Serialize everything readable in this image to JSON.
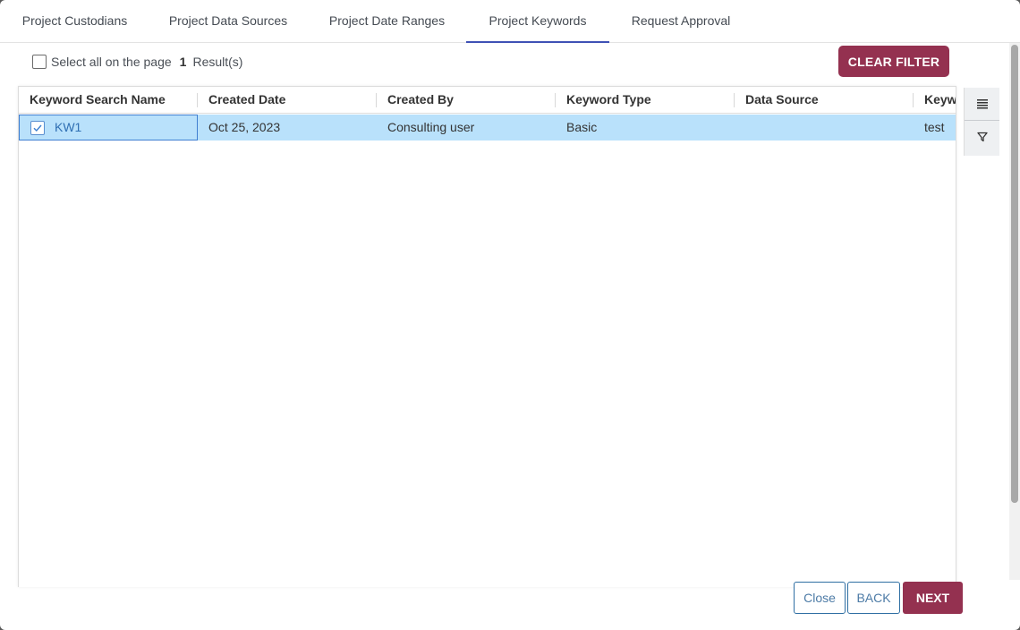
{
  "tabs": [
    {
      "label": "Project Custodians"
    },
    {
      "label": "Project Data Sources"
    },
    {
      "label": "Project Date Ranges"
    },
    {
      "label": "Project Keywords",
      "active": true
    },
    {
      "label": "Request Approval"
    }
  ],
  "toolbar": {
    "select_all_label": "Select all on the page",
    "result_count": "1",
    "results_label": "Result(s)",
    "clear_filter_label": "CLEAR FILTER"
  },
  "grid": {
    "columns": [
      "Keyword Search Name",
      "Created Date",
      "Created By",
      "Keyword Type",
      "Data Source",
      "Keyw"
    ],
    "rows": [
      {
        "selected": true,
        "keyword_search_name": "KW1",
        "created_date": "Oct 25, 2023",
        "created_by": "Consulting user",
        "keyword_type": "Basic",
        "data_source": "",
        "keywords": "test"
      }
    ]
  },
  "side_panel": {
    "icons": [
      "columns-icon",
      "filter-icon"
    ]
  },
  "footer": {
    "close_label": "Close",
    "back_label": "BACK",
    "next_label": "NEXT"
  },
  "colors": {
    "accent": "#943150",
    "tab_indicator": "#3f51b5",
    "selected_row": "#b9e1fb",
    "link": "#2f6fb3"
  }
}
